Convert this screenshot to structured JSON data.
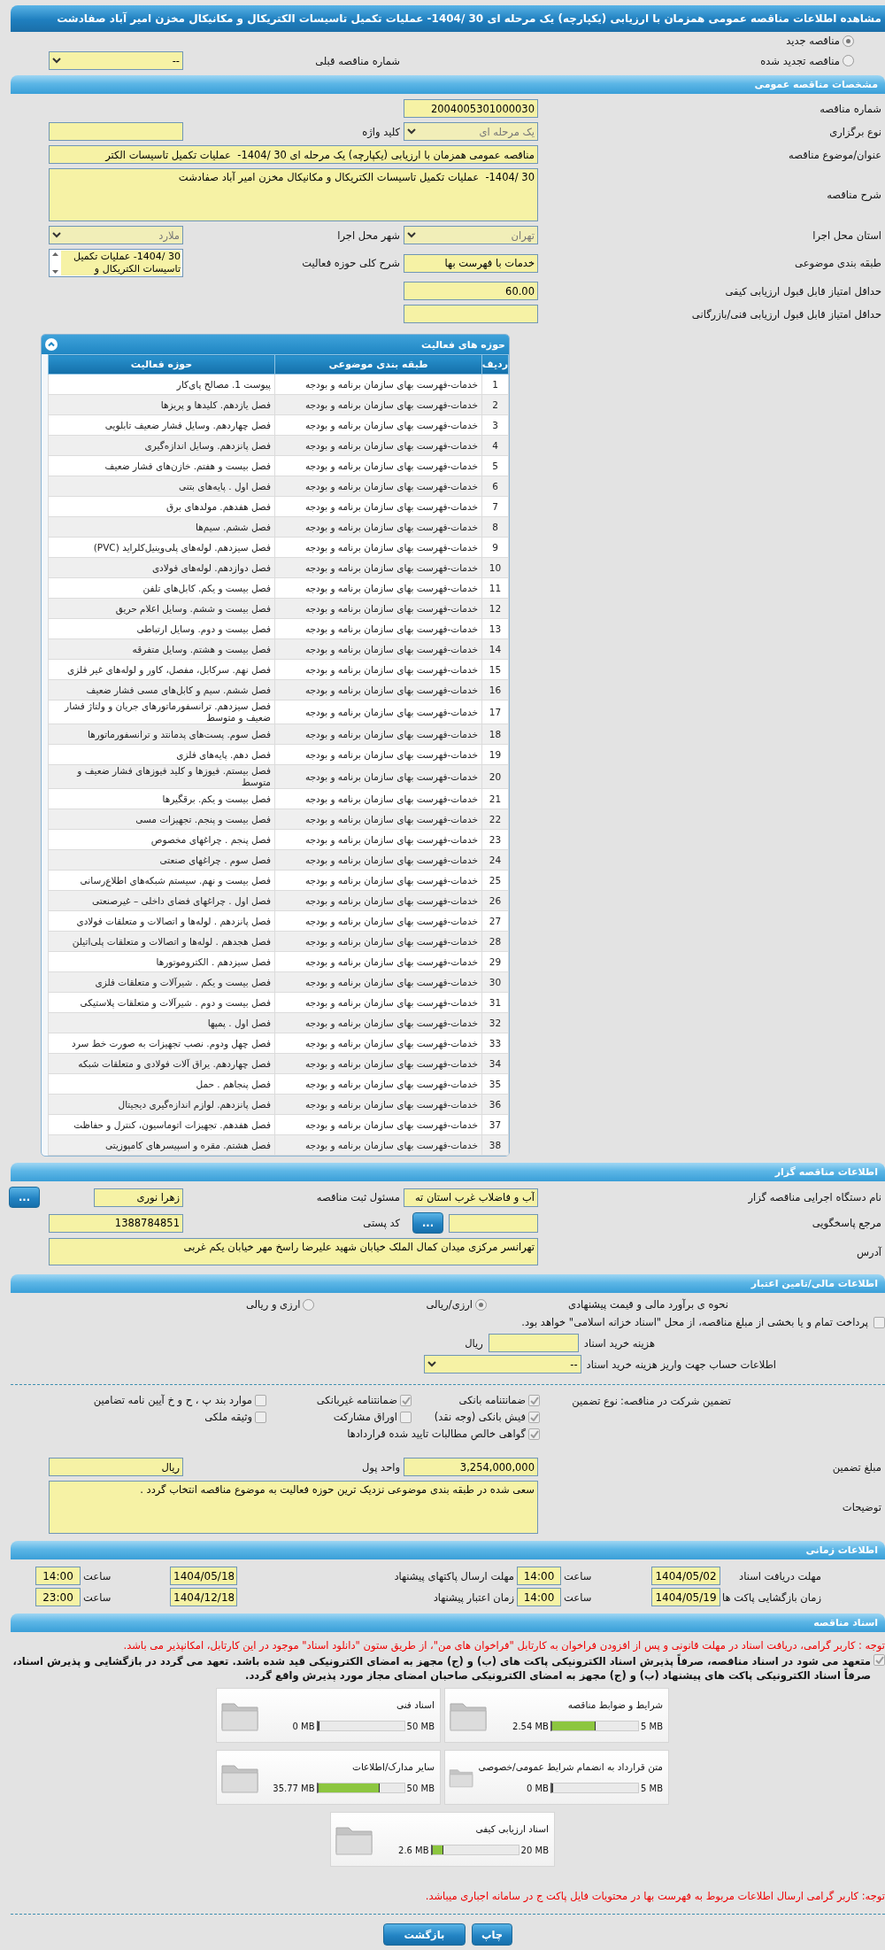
{
  "title": "مشاهده اطلاعات مناقصه عمومی همزمان با ارزیابی (یکپارچه) یک مرحله ای 30 /1404-  عملیات تکمیل تاسیسات الکتریکال و مکانیکال مخزن امیر آباد صفادشت",
  "tender_status": [
    {
      "label": "مناقصه جدید",
      "selected": true
    },
    {
      "label": "مناقصه تجدید شده",
      "selected": false
    }
  ],
  "previous_tender": {
    "kind": "select",
    "label": "شماره مناقصه قبلی",
    "value": "--",
    "disabled": false
  },
  "general": {
    "header": "مشخصات مناقصه عمومی",
    "rows": [
      {
        "right": {
          "kind": "text",
          "label": "شماره مناقصه",
          "value": "2004005301000030"
        }
      },
      {
        "right": {
          "kind": "select",
          "label": "نوع برگزاری",
          "value": "یک مرحله ای",
          "disabled": true
        },
        "left": {
          "kind": "text",
          "label": "کلید واژه"
        }
      },
      {
        "right": {
          "kind": "long_text",
          "label": "عنوان/موضوع مناقصه",
          "value": "مناقصه عمومی همزمان با ارزیابی (یکپارچه) یک مرحله ای 30 /1404-  عملیات تکمیل تاسیسات الکتر"
        }
      },
      {
        "right": {
          "kind": "textarea",
          "label": "شرح مناقصه",
          "value": "30 /1404-  عملیات تکمیل تاسیسات الکتریکال و مکانیکال مخزن امیر آباد صفادشت"
        }
      },
      {
        "right": {
          "kind": "select",
          "label": "استان محل اجرا",
          "value": "تهران",
          "disabled": true
        },
        "left": {
          "kind": "select",
          "label": "شهر محل اجرا",
          "value": "ملارد",
          "disabled": true
        }
      },
      {
        "right": {
          "kind": "text",
          "label": "طبقه بندی موضوعی",
          "value": "خدمات با فهرست بها"
        },
        "left": {
          "kind": "listbox",
          "label": "شرح کلی حوزه فعالیت",
          "value": "30 /1404-  عملیات تکمیل تاسیسات الکتریکال و"
        }
      },
      {
        "right": {
          "kind": "text",
          "label": "حداقل امتیاز قابل قبول ارزیابی کیفی",
          "value": "60.00"
        }
      },
      {
        "right": {
          "kind": "text",
          "label": "حداقل امتیاز قابل قبول ارزیابی فنی/بازرگانی"
        }
      }
    ]
  },
  "activities": {
    "header": "حوزه های فعالیت",
    "columns": [
      "ردیف",
      "طبقه بندی موضوعی",
      "حوزه فعالیت"
    ],
    "rows": [
      [
        "1",
        "خدمات-فهرست بهای سازمان برنامه و بودجه",
        "پیوست 1. مصالح پای‌کار"
      ],
      [
        "2",
        "خدمات-فهرست بهای سازمان برنامه و بودجه",
        "فصل یازدهم. کلیدها و پریزها"
      ],
      [
        "3",
        "خدمات-فهرست بهای سازمان برنامه و بودجه",
        "فصل چهاردهم. وسایل فشار ضعیف تابلویی"
      ],
      [
        "4",
        "خدمات-فهرست بهای سازمان برنامه و بودجه",
        "فصل پانزدهم. وسایل اندازه‌گیری"
      ],
      [
        "5",
        "خدمات-فهرست بهای سازمان برنامه و بودجه",
        "فصل بیست و هفتم. خازن‌های فشار ضعیف"
      ],
      [
        "6",
        "خدمات-فهرست بهای سازمان برنامه و بودجه",
        "فصل اول . پایه‌های بتنی"
      ],
      [
        "7",
        "خدمات-فهرست بهای سازمان برنامه و بودجه",
        "فصل هفدهم. مولدهای برق"
      ],
      [
        "8",
        "خدمات-فهرست بهای سازمان برنامه و بودجه",
        "فصل ششم. سیم‌ها"
      ],
      [
        "9",
        "خدمات-فهرست بهای سازمان برنامه و بودجه",
        "فصل سیزدهم. لوله‌های پلی‌وینیل‌کلراید (PVC)"
      ],
      [
        "10",
        "خدمات-فهرست بهای سازمان برنامه و بودجه",
        "فصل دوازدهم. لوله‌های فولادی"
      ],
      [
        "11",
        "خدمات-فهرست بهای سازمان برنامه و بودجه",
        "فصل بیست و یکم. کابل‌های تلفن"
      ],
      [
        "12",
        "خدمات-فهرست بهای سازمان برنامه و بودجه",
        "فصل بیست و ششم. وسایل اعلام حریق"
      ],
      [
        "13",
        "خدمات-فهرست بهای سازمان برنامه و بودجه",
        "فصل بیست و دوم. وسایل ارتباطی"
      ],
      [
        "14",
        "خدمات-فهرست بهای سازمان برنامه و بودجه",
        "فصل بیست و هشتم. وسایل متفرقه"
      ],
      [
        "15",
        "خدمات-فهرست بهای سازمان برنامه و بودجه",
        "فصل نهم. سرکابل، مفصل، کاور و لوله‌های غیر فلزی"
      ],
      [
        "16",
        "خدمات-فهرست بهای سازمان برنامه و بودجه",
        "فصل ششم. سیم و کابل‌های مسی فشار ضعیف"
      ],
      [
        "17",
        "خدمات-فهرست بهای سازمان برنامه و بودجه",
        "فصل سیزدهم. ترانسفورماتورهای جریان و ولتاژ فشار ضعیف و متوسط"
      ],
      [
        "18",
        "خدمات-فهرست بهای سازمان برنامه و بودجه",
        "فصل سوم. پست‌های پدمانتد و ترانسفورماتورها"
      ],
      [
        "19",
        "خدمات-فهرست بهای سازمان برنامه و بودجه",
        "فصل دهم. پایه‌های فلزی"
      ],
      [
        "20",
        "خدمات-فهرست بهای سازمان برنامه و بودجه",
        "فصل بیستم. فیوزها و کلید فیوزهای فشار ضعیف و متوسط"
      ],
      [
        "21",
        "خدمات-فهرست بهای سازمان برنامه و بودجه",
        "فصل بیست و یکم. برقگیرها"
      ],
      [
        "22",
        "خدمات-فهرست بهای سازمان برنامه و بودجه",
        "فصل بیست و پنجم. تجهیزات مسی"
      ],
      [
        "23",
        "خدمات-فهرست بهای سازمان برنامه و بودجه",
        "فصل پنجم . چراغهای مخصوص"
      ],
      [
        "24",
        "خدمات-فهرست بهای سازمان برنامه و بودجه",
        "فصل سوم . چراغهای صنعتی"
      ],
      [
        "25",
        "خدمات-فهرست بهای سازمان برنامه و بودجه",
        "فصل بیست و نهم. سیستم شبکه‌های اطلاع‌رسانی"
      ],
      [
        "26",
        "خدمات-فهرست بهای سازمان برنامه و بودجه",
        "فصل اول . چراغهای فضای داخلی – غیرصنعتی"
      ],
      [
        "27",
        "خدمات-فهرست بهای سازمان برنامه و بودجه",
        "فصل پانزدهم . لوله‌ها و اتصالات و متعلقات فولادی"
      ],
      [
        "28",
        "خدمات-فهرست بهای سازمان برنامه و بودجه",
        "فصل هجدهم . لوله‌ها و اتصالات و متعلقات  پلی‌اتیلن"
      ],
      [
        "29",
        "خدمات-فهرست بهای سازمان برنامه و بودجه",
        "فصل سیزدهم . الکتروموتورها"
      ],
      [
        "30",
        "خدمات-فهرست بهای سازمان برنامه و بودجه",
        "فصل بیست و یکم . شیرآلات و متعلقات فلزی"
      ],
      [
        "31",
        "خدمات-فهرست بهای سازمان برنامه و بودجه",
        "فصل بیست و دوم . شیرآلات و متعلقات پلاستیکی"
      ],
      [
        "32",
        "خدمات-فهرست بهای سازمان برنامه و بودجه",
        "فصل اول . پمپها"
      ],
      [
        "33",
        "خدمات-فهرست بهای سازمان برنامه و بودجه",
        "فصل چهل ودوم. نصب تجهیزات به صورت خط سرد"
      ],
      [
        "34",
        "خدمات-فهرست بهای سازمان برنامه و بودجه",
        "فصل چهاردهم. یراق آلات فولادی و متعلقات شبکه"
      ],
      [
        "35",
        "خدمات-فهرست بهای سازمان برنامه و بودجه",
        "فصل پنجاهم . حمل"
      ],
      [
        "36",
        "خدمات-فهرست بهای سازمان برنامه و بودجه",
        "فصل پانزدهم. لوازم اندازه‌گیری دیجیتال"
      ],
      [
        "37",
        "خدمات-فهرست بهای سازمان برنامه و بودجه",
        "فصل هفدهم. تجهیزات اتوماسیون، کنترل و حفاظت"
      ],
      [
        "38",
        "خدمات-فهرست بهای سازمان برنامه و بودجه",
        "فصل هشتم. مقره و اسپیسرهای کامپوزیتی"
      ]
    ]
  },
  "organizer": {
    "header": "اطلاعات مناقصه گزار",
    "rows": [
      {
        "right": {
          "kind": "text",
          "label": "نام دستگاه اجرایی مناقصه گزار",
          "value": "آب و فاضلاب غرب استان ته"
        },
        "left": {
          "kind": "text",
          "label": "مسئول ثبت مناقصه",
          "value": "زهرا نوری",
          "button": "..."
        }
      },
      {
        "right": {
          "kind": "text",
          "label": "مرجع پاسخگویی",
          "button": "..."
        },
        "left": {
          "kind": "text",
          "label": "کد پستی",
          "value": "1388784851"
        }
      },
      {
        "right": {
          "kind": "short_textarea",
          "label": "آدرس",
          "value": "تهرانسر مرکزی میدان کمال الملک خیابان شهید علیرضا راسخ مهر خیابان یکم غربی"
        }
      }
    ]
  },
  "finance": {
    "header": "اطلاعات مالی/تامین اعتبار",
    "estimate": {
      "label": "نحوه ی برآورد مالی و قیمت پیشنهادی",
      "options": [
        {
          "label": "ارزی/ریالی",
          "selected": true
        },
        {
          "label": "ارزی و ریالی",
          "selected": false
        }
      ]
    },
    "treasury": {
      "label": "پرداخت تمام و یا بخشی از مبلغ مناقصه، از محل \"اسناد خزانه اسلامی\" خواهد بود.",
      "checked": false
    },
    "doc_cost": {
      "label": "هزینه خرید اسناد",
      "unit": "ریال"
    },
    "account": {
      "kind": "select",
      "label": "اطلاعات حساب جهت واریز هزینه خرید اسناد",
      "value": "--",
      "disabled": false
    }
  },
  "guarantee": {
    "label": "تضمین شرکت در مناقصه:",
    "type_label": "نوع تضمین",
    "options": [
      {
        "label": "ضمانتنامه بانکی",
        "checked": true
      },
      {
        "label": "ضمانتنامه غیربانکی",
        "checked": true
      },
      {
        "label": "موارد بند پ ، ح و خ آیین نامه تضامین",
        "checked": false
      },
      {
        "label": "فیش بانکی (وجه نقد)",
        "checked": true
      },
      {
        "label": "اوراق مشارکت",
        "checked": false
      },
      {
        "label": "وثیقه ملکی",
        "checked": false
      },
      {
        "label": "گواهی خالص مطالبات تایید شده قراردادها",
        "checked": true
      }
    ],
    "rows": [
      {
        "right": {
          "kind": "text",
          "label": "مبلغ تضمین",
          "value": "3,254,000,000"
        },
        "left": {
          "kind": "text",
          "label": "واحد پول",
          "value": "ریال"
        }
      },
      {
        "right": {
          "kind": "textarea",
          "label": "توضیحات",
          "value": "سعی شده در طبقه بندی موضوعی نزدیک ترین حوزه فعالیت به موضوع مناقصه انتخاب گردد ."
        }
      }
    ]
  },
  "schedule": {
    "header": "اطلاعات زمانی",
    "items": [
      {
        "label": "مهلت دریافت اسناد",
        "date": "1404/05/02",
        "time_label": "ساعت",
        "time": "14:00"
      },
      {
        "label": "مهلت ارسال پاکتهای پیشنهاد",
        "date": "1404/05/18",
        "time_label": "ساعت",
        "time": "14:00"
      },
      {
        "label": "زمان بازگشایی پاکت ها",
        "date": "1404/05/19",
        "time_label": "ساعت",
        "time": "14:00"
      },
      {
        "label": "زمان اعتبار پیشنهاد",
        "date": "1404/12/18",
        "time_label": "ساعت",
        "time": "23:00"
      }
    ]
  },
  "documents": {
    "header": "اسناد مناقصه",
    "notice": "توجه : کاربر گرامی، دریافت اسناد در مهلت قانونی و پس از افزودن فراخوان به کارتابل \"فراخوان های من\"، از طریق ستون \"دانلود اسناد\" موجود در این کارتابل، امکانپذیر می باشد.",
    "commitment": {
      "checked": true,
      "text": "متعهد می شود در اسناد مناقصه، صرفاً پذیرش اسناد الکترونیکی پاکت های (ب) و (ج) مجهز به امضای الکترونیکی قید شده باشد. تعهد می گردد در بازگشایی و پذیرش اسناد، صرفاً اسناد الکترونیکی پاکت های پیشنهاد (ب) و (ج) مجهز به امضای الکترونیکی صاحبان امضای مجاز مورد پذیرش واقع گردد."
    },
    "files": [
      {
        "title": "شرایط و ضوابط مناقصه",
        "used": "2.54 MB",
        "max": "5 MB",
        "level": 0.508
      },
      {
        "title": "اسناد فنی",
        "used": "0 MB",
        "max": "50 MB",
        "level": 0
      },
      {
        "title": "متن قرارداد به انضمام شرایط عمومی/خصوصی",
        "used": "0 MB",
        "max": "5 MB",
        "level": 0
      },
      {
        "title": "سایر مدارک/اطلاعات",
        "used": "35.77 MB",
        "max": "50 MB",
        "level": 0.7154
      },
      {
        "title": "اسناد ارزیابی کیفی",
        "used": "2.6 MB",
        "max": "20 MB",
        "level": 0.13
      }
    ],
    "footer_notice": "توجه: کاربر گرامی ارسال اطلاعات مربوط به فهرست بها در محتویات فایل پاکت ج در سامانه اجباری میباشد."
  },
  "buttons": [
    "چاپ",
    "بازگشت"
  ]
}
